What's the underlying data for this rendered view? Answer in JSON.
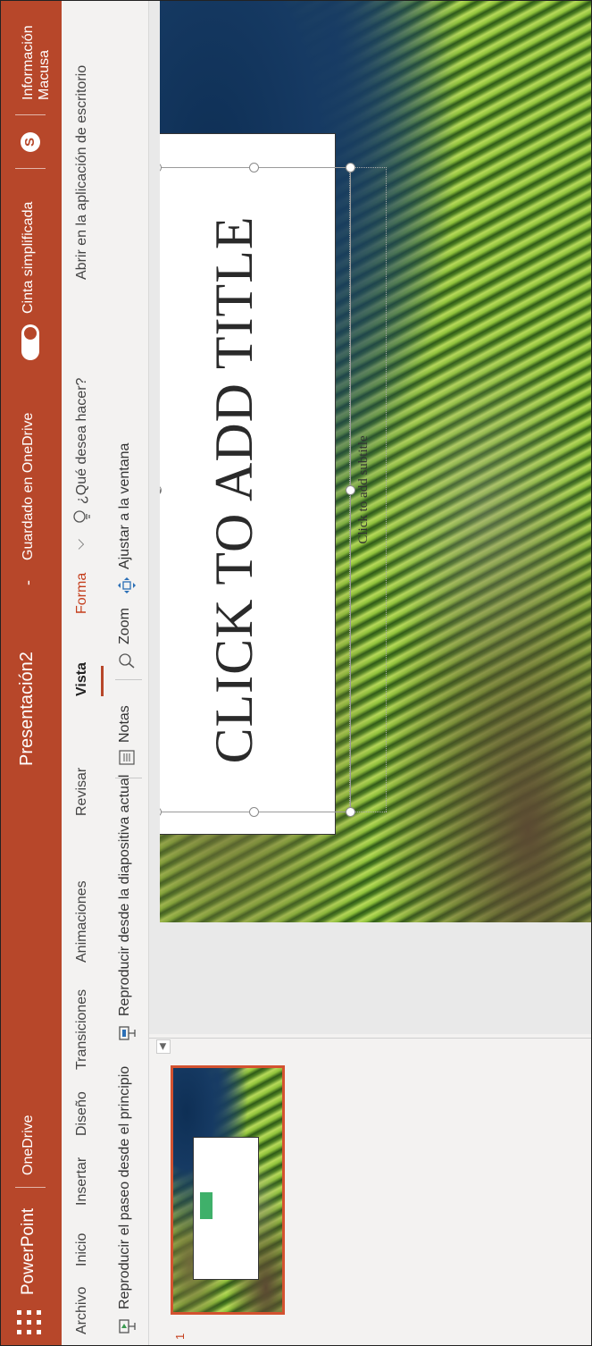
{
  "titlebar": {
    "app_name": "PowerPoint",
    "onedrive": "OneDrive",
    "doc_title": "Presentación2",
    "separator": "-",
    "save_status": "Guardado en OneDrive",
    "simplified_ribbon": "Cinta simplificada",
    "user": "Información Macusa",
    "skype_glyph": "S"
  },
  "tabs": {
    "items": [
      "Archivo",
      "Inicio",
      "Insertar",
      "Diseño",
      "Transiciones",
      "Animaciones",
      "Revisar",
      "Vista",
      "Forma"
    ],
    "active": "Vista",
    "contextual": "Forma",
    "tell_me": "¿Qué desea hacer?",
    "open_desktop": "Abrir en la aplicación de escritorio"
  },
  "commands": {
    "play_walkthrough": "Reproducir el paseo desde el principio",
    "play_current": "Reproducir desde la diapositiva actual",
    "notes": "Notas",
    "zoom": "Zoom",
    "fit_window": "Ajustar a la ventana"
  },
  "thumbnails": {
    "slide_number": "1"
  },
  "slide": {
    "title": "CLICK TO ADD TITLE",
    "subtitle": "Click to add subtitle"
  },
  "colors": {
    "brand": "#b7472a",
    "accent_green": "#3fb06a",
    "thumb_border": "#d35230"
  },
  "icons": {
    "waffle": "app-launcher-icon",
    "tellme": "lightbulb-icon",
    "notes": "notes-icon",
    "zoom": "zoom-icon",
    "fit": "fit-window-icon",
    "rotate": "rotate-handle-icon",
    "skype": "skype-icon"
  }
}
